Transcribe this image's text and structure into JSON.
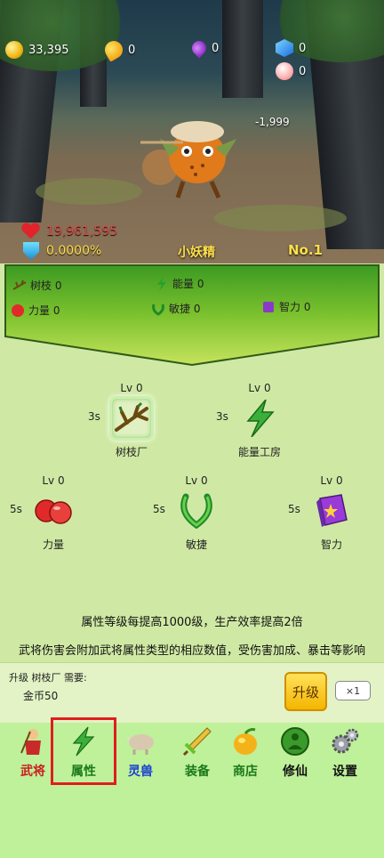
{
  "resources": [
    {
      "name": "gold",
      "value": "33,395"
    },
    {
      "name": "mango",
      "value": "0"
    },
    {
      "name": "essence",
      "value": "0"
    },
    {
      "name": "gem",
      "value": "0"
    },
    {
      "name": "peach",
      "value": "0"
    }
  ],
  "battle": {
    "damage_popup": "-1,999",
    "hp": "19,961,595",
    "defense_pct": "0.0000%",
    "monster_name": "小妖精",
    "stage": "No.1"
  },
  "stats": {
    "branch": "树枝 0",
    "energy": "能量 0",
    "power": "力量 0",
    "agility": "敏捷 0",
    "intellect": "智力 0"
  },
  "nodes": [
    {
      "lv": "Lv 0",
      "time": "3s",
      "name": "树枝厂"
    },
    {
      "lv": "Lv 0",
      "time": "3s",
      "name": "能量工房"
    },
    {
      "lv": "Lv 0",
      "time": "5s",
      "name": "力量"
    },
    {
      "lv": "Lv 0",
      "time": "5s",
      "name": "敏捷"
    },
    {
      "lv": "Lv 0",
      "time": "5s",
      "name": "智力"
    }
  ],
  "info": {
    "line1": "属性等级每提高1000级，生产效率提高2倍",
    "line2": "武将伤害会附加武将属性类型的相应数值，受伤害加成、暴击等影响"
  },
  "upgrade": {
    "requirement": "升级 树枝厂 需要:",
    "cost": "金币50",
    "button": "升级",
    "multiplier": "×1"
  },
  "nav": [
    {
      "label": "武将",
      "color": "#c81e1e"
    },
    {
      "label": "属性",
      "color": "#1a7a1a"
    },
    {
      "label": "灵兽",
      "color": "#1a3fd0"
    },
    {
      "label": "装备",
      "color": "#1a7a1a"
    },
    {
      "label": "商店",
      "color": "#1a7a1a"
    },
    {
      "label": "修仙",
      "color": "#111111"
    },
    {
      "label": "设置",
      "color": "#111111"
    }
  ],
  "active_tab": "属性"
}
